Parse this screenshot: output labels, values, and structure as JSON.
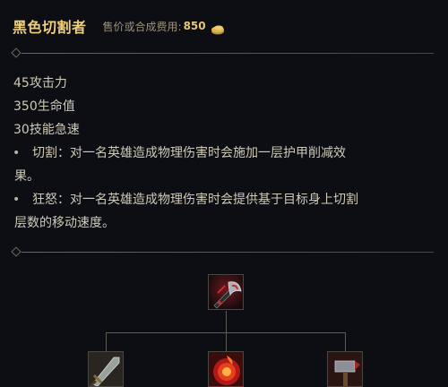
{
  "item": {
    "name": "黑色切割者",
    "price_label": "售价或合成费用:",
    "price_value": "850"
  },
  "stats": [
    "45攻击力",
    "350生命值",
    "30技能急速"
  ],
  "passives": [
    {
      "bullet": "•",
      "line1": "切割：对一名英雄造成物理伤害时会施加一层护甲削减效",
      "line2": "果。"
    },
    {
      "bullet": "•",
      "line1": "狂怒：对一名英雄造成物理伤害时会提供基于目标身上切割",
      "line2": "层数的移动速度。"
    }
  ],
  "recipe": {
    "top": {
      "icon": "black-cleaver-icon"
    },
    "components": [
      {
        "icon": "caulfields-warhammer-sword-icon"
      },
      {
        "icon": "kindlegem-icon"
      },
      {
        "icon": "phage-hammer-icon"
      }
    ]
  },
  "colors": {
    "background": "#0c0e14",
    "title": "#f0cf7c",
    "body_text": "#cfcab8",
    "price_label": "#9b927c",
    "divider": "#6b6657"
  }
}
